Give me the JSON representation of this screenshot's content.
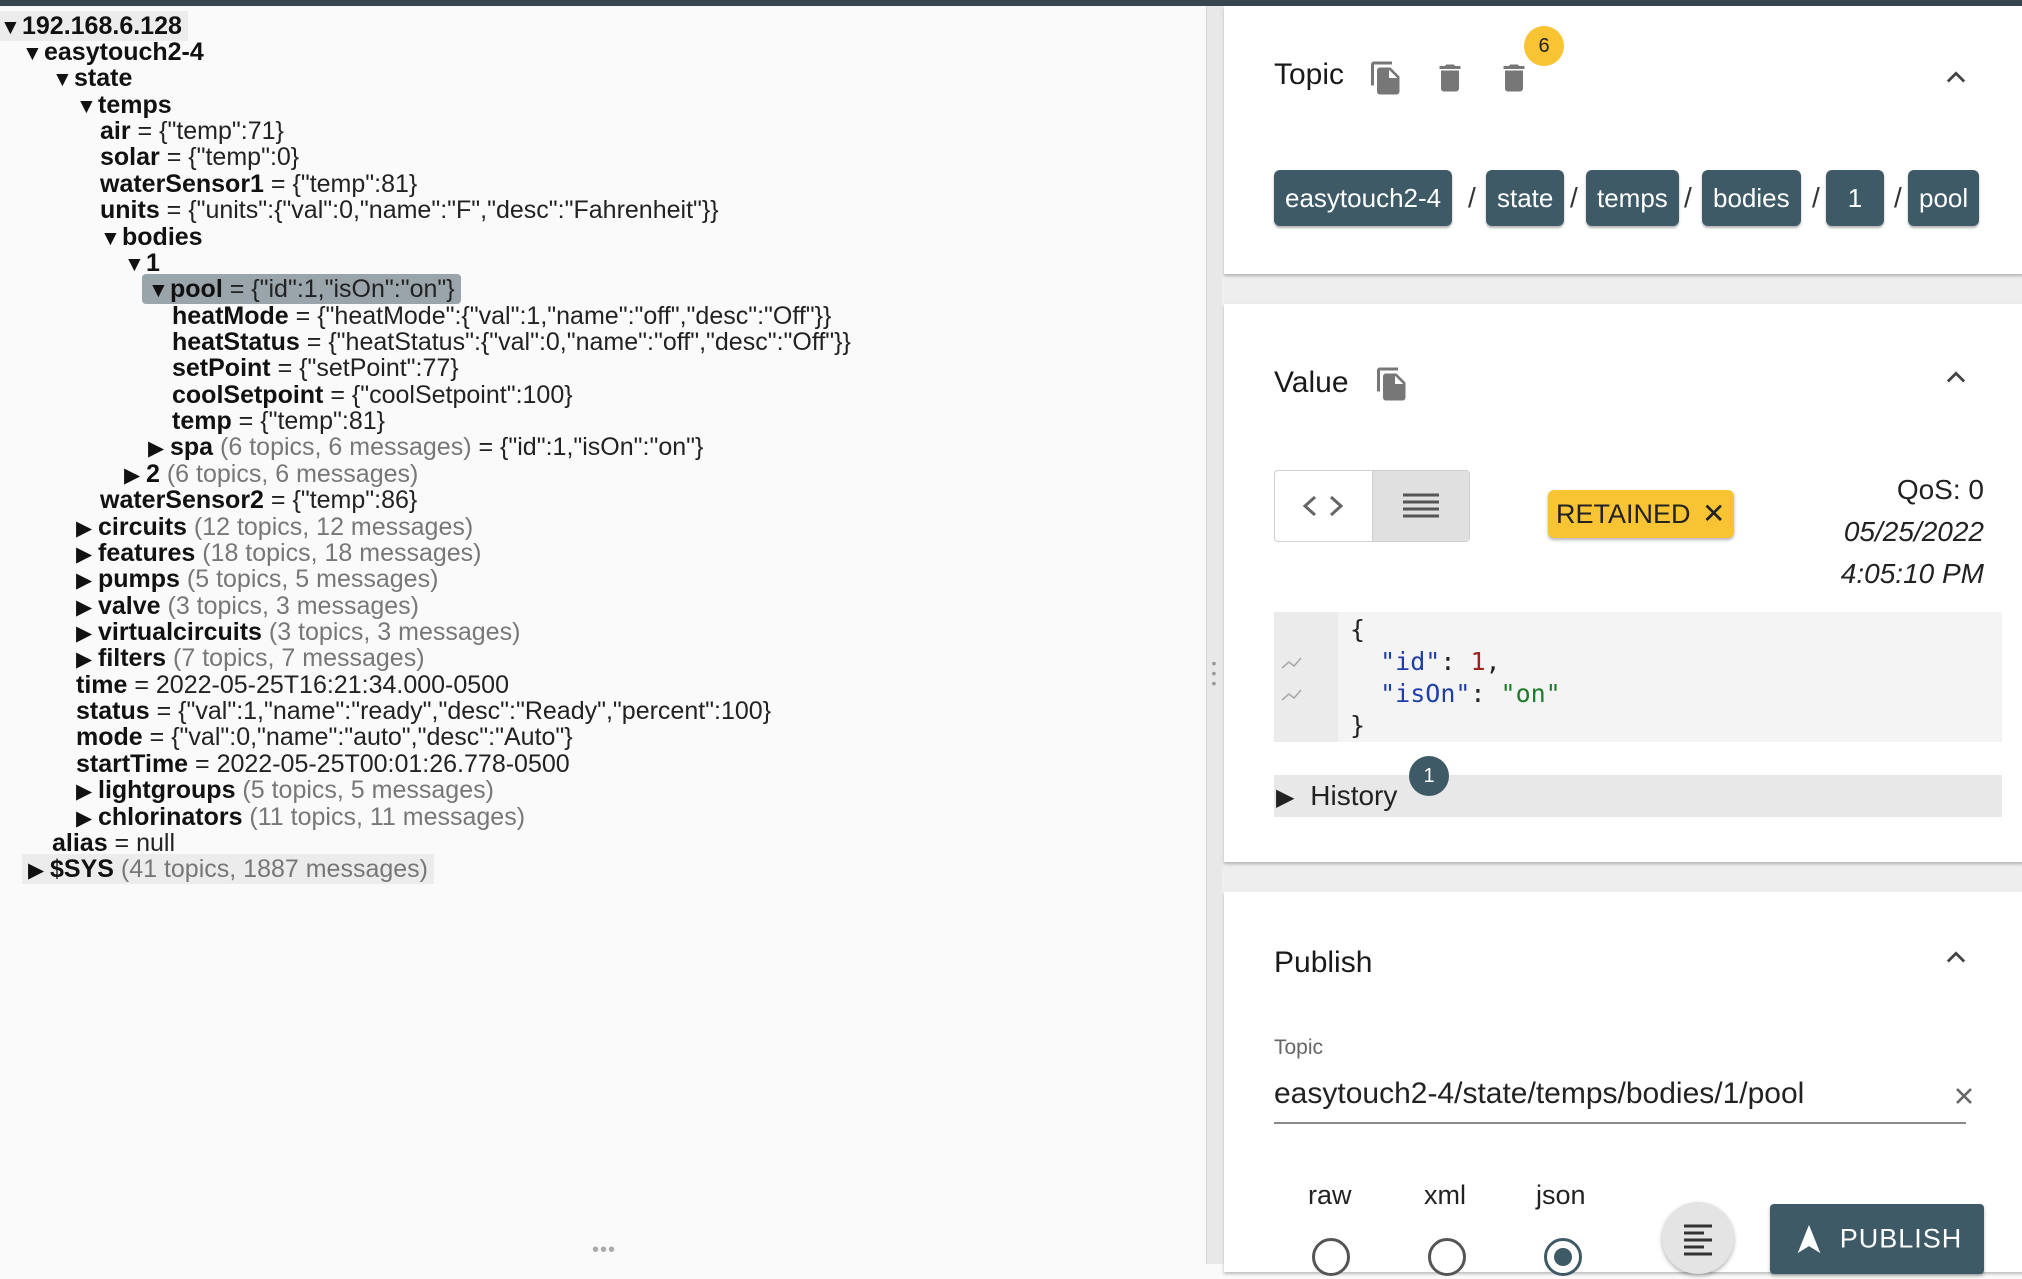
{
  "tree": {
    "rows": [
      {
        "arrow": "▼",
        "key": "192.168.6.128",
        "eq": "",
        "value": "",
        "count": ""
      },
      {
        "arrow": "▼",
        "key": "easytouch2-4",
        "eq": "",
        "value": "",
        "count": ""
      },
      {
        "arrow": "▼",
        "key": "state",
        "eq": "",
        "value": "",
        "count": ""
      },
      {
        "arrow": "▼",
        "key": "temps",
        "eq": "",
        "value": "",
        "count": ""
      },
      {
        "arrow": "",
        "key": "air",
        "eq": " = ",
        "value": "{\"temp\":71}",
        "count": ""
      },
      {
        "arrow": "",
        "key": "solar",
        "eq": " = ",
        "value": "{\"temp\":0}",
        "count": ""
      },
      {
        "arrow": "",
        "key": "waterSensor1",
        "eq": " = ",
        "value": "{\"temp\":81}",
        "count": ""
      },
      {
        "arrow": "",
        "key": "units",
        "eq": " = ",
        "value": "{\"units\":{\"val\":0,\"name\":\"F\",\"desc\":\"Fahrenheit\"}}",
        "count": ""
      },
      {
        "arrow": "▼",
        "key": "bodies",
        "eq": "",
        "value": "",
        "count": ""
      },
      {
        "arrow": "▼",
        "key": "1",
        "eq": "",
        "value": "",
        "count": ""
      },
      {
        "arrow": "▼",
        "key": "pool",
        "eq": " = ",
        "value": "{\"id\":1,\"isOn\":\"on\"}",
        "count": ""
      },
      {
        "arrow": "",
        "key": "heatMode",
        "eq": " = ",
        "value": "{\"heatMode\":{\"val\":1,\"name\":\"off\",\"desc\":\"Off\"}}",
        "count": ""
      },
      {
        "arrow": "",
        "key": "heatStatus",
        "eq": " = ",
        "value": "{\"heatStatus\":{\"val\":0,\"name\":\"off\",\"desc\":\"Off\"}}",
        "count": ""
      },
      {
        "arrow": "",
        "key": "setPoint",
        "eq": " = ",
        "value": "{\"setPoint\":77}",
        "count": ""
      },
      {
        "arrow": "",
        "key": "coolSetpoint",
        "eq": " = ",
        "value": "{\"coolSetpoint\":100}",
        "count": ""
      },
      {
        "arrow": "",
        "key": "temp",
        "eq": " = ",
        "value": "{\"temp\":81}",
        "count": ""
      },
      {
        "arrow": "▶",
        "key": "spa",
        "eq": " = ",
        "value": "{\"id\":1,\"isOn\":\"on\"}",
        "count": " (6 topics, 6 messages)"
      },
      {
        "arrow": "▶",
        "key": "2",
        "eq": "",
        "value": "",
        "count": " (6 topics, 6 messages)"
      },
      {
        "arrow": "",
        "key": "waterSensor2",
        "eq": " = ",
        "value": "{\"temp\":86}",
        "count": ""
      },
      {
        "arrow": "▶",
        "key": "circuits",
        "eq": "",
        "value": "",
        "count": " (12 topics, 12 messages)"
      },
      {
        "arrow": "▶",
        "key": "features",
        "eq": "",
        "value": "",
        "count": " (18 topics, 18 messages)"
      },
      {
        "arrow": "▶",
        "key": "pumps",
        "eq": "",
        "value": "",
        "count": " (5 topics, 5 messages)"
      },
      {
        "arrow": "▶",
        "key": "valve",
        "eq": "",
        "value": "",
        "count": " (3 topics, 3 messages)"
      },
      {
        "arrow": "▶",
        "key": "virtualcircuits",
        "eq": "",
        "value": "",
        "count": " (3 topics, 3 messages)"
      },
      {
        "arrow": "▶",
        "key": "filters",
        "eq": "",
        "value": "",
        "count": " (7 topics, 7 messages)"
      },
      {
        "arrow": "",
        "key": "time",
        "eq": " = ",
        "value": "2022-05-25T16:21:34.000-0500",
        "count": ""
      },
      {
        "arrow": "",
        "key": "status",
        "eq": " = ",
        "value": "{\"val\":1,\"name\":\"ready\",\"desc\":\"Ready\",\"percent\":100}",
        "count": ""
      },
      {
        "arrow": "",
        "key": "mode",
        "eq": " = ",
        "value": "{\"val\":0,\"name\":\"auto\",\"desc\":\"Auto\"}",
        "count": ""
      },
      {
        "arrow": "",
        "key": "startTime",
        "eq": " = ",
        "value": "2022-05-25T00:01:26.778-0500",
        "count": ""
      },
      {
        "arrow": "▶",
        "key": "lightgroups",
        "eq": "",
        "value": "",
        "count": " (5 topics, 5 messages)"
      },
      {
        "arrow": "▶",
        "key": "chlorinators",
        "eq": "",
        "value": "",
        "count": " (11 topics, 11 messages)"
      },
      {
        "arrow": "",
        "key": "alias",
        "eq": " = ",
        "value": "null",
        "count": ""
      },
      {
        "arrow": "▶",
        "key": "$SYS",
        "eq": "",
        "value": "",
        "count": " (41 topics, 1887 messages)"
      }
    ]
  },
  "topic_panel": {
    "title": "Topic",
    "delete_badge": "6",
    "breadcrumb": [
      "easytouch2-4",
      "state",
      "temps",
      "bodies",
      "1",
      "pool"
    ],
    "separator": "/"
  },
  "value_panel": {
    "title": "Value",
    "retained_label": "RETAINED",
    "qos": "QoS: 0",
    "date": "05/25/2022",
    "time": "4:05:10 PM",
    "json": {
      "open": "{",
      "close": "}",
      "key1": "\"id\"",
      "val1": "1",
      "key2": "\"isOn\"",
      "val2": "\"on\""
    },
    "history_label": "History",
    "history_badge": "1"
  },
  "publish_panel": {
    "title": "Publish",
    "topic_label": "Topic",
    "topic_value": "easytouch2-4/state/temps/bodies/1/pool",
    "formats": [
      "raw",
      "xml",
      "json"
    ],
    "selected_format": "json",
    "publish_label": "PUBLISH"
  },
  "colors": {
    "chip": "#3d5a66",
    "badge_yellow": "#f8c434",
    "selection": "#9aa4ab"
  }
}
